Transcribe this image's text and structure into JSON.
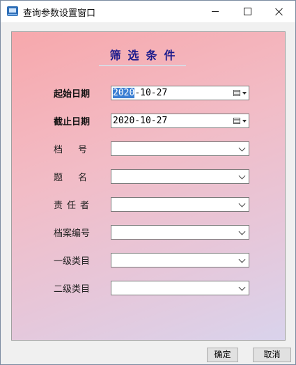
{
  "window": {
    "title": "查询参数设置窗口"
  },
  "panel": {
    "title": "筛选条件"
  },
  "fields": {
    "start_date": {
      "label": "起始日期",
      "value_selected": "2020",
      "value_rest": "-10-27"
    },
    "end_date": {
      "label": "截止日期",
      "value": "2020-10-27"
    },
    "archive_no": {
      "label": "档号",
      "value": ""
    },
    "title_field": {
      "label": "题名",
      "value": ""
    },
    "responsible": {
      "label": "责任者",
      "value": ""
    },
    "file_no": {
      "label": "档案编号",
      "value": ""
    },
    "category1": {
      "label": "一级类目",
      "value": ""
    },
    "category2": {
      "label": "二级类目",
      "value": ""
    }
  },
  "buttons": {
    "ok": "确定",
    "cancel": "取消"
  },
  "colors": {
    "title_text": "#1a1a8c",
    "selection": "#3b7fd3"
  }
}
